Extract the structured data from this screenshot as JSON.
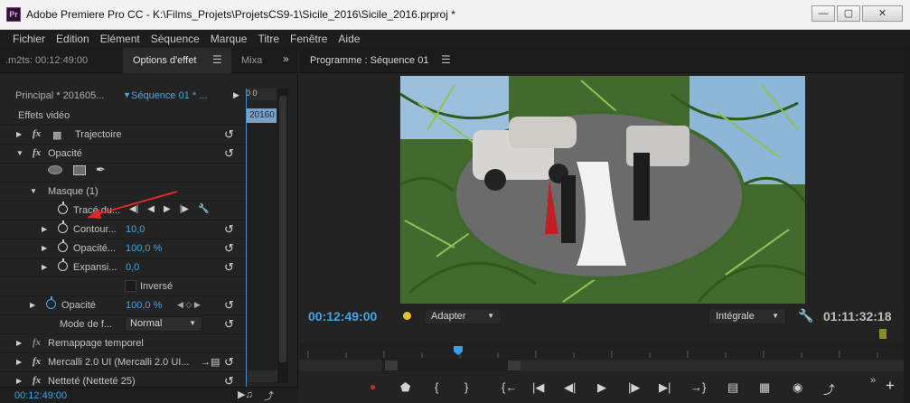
{
  "window": {
    "title": "Adobe Premiere Pro CC - K:\\Films_Projets\\ProjetsCS9-1\\Sicile_2016\\Sicile_2016.prproj *",
    "app_icon_text": "Pr"
  },
  "menu": [
    "Fichier",
    "Edition",
    "Elément",
    "Séquence",
    "Marque",
    "Titre",
    "Fenêtre",
    "Aide"
  ],
  "left_panel": {
    "tab_prev": ".m2ts: 00:12:49:00",
    "tab_active": "Options d'effet",
    "tab_next": "Mixa",
    "sequence_master": "Principal * 201605...",
    "sequence_clip": "Séquence 01 * ...",
    "timeline_ruler_label": "0 0",
    "timeline_clip_label": "20160",
    "section_label": "Effets vidéo",
    "rows": {
      "trajectoire": "Trajectoire",
      "opacite": "Opacité",
      "masque": "Masque (1)",
      "trace": "Tracé du...",
      "contour": "Contour...",
      "contour_val": "10,0",
      "opacite_masque": "Opacité...",
      "opacite_masque_val": "100,0 %",
      "expansion": "Expansi...",
      "expansion_val": "0,0",
      "inverse": "Inversé",
      "opacite2": "Opacité",
      "opacite2_val": "100,0 %",
      "mode": "Mode de f...",
      "mode_val": "Normal",
      "remappage": "Remappage temporel",
      "mercalli": "Mercalli 2.0 UI (Mercalli 2.0 UI...",
      "nettete": "Netteté (Netteté 25)"
    },
    "footer_timecode": "00:12:49:00"
  },
  "program_monitor": {
    "tab_label": "Programme : Séquence 01",
    "timecode_current": "00:12:49:00",
    "fit_label": "Adapter",
    "resolution_label": "Intégrale",
    "timecode_duration": "01:11:32:18"
  },
  "colors": {
    "accent_blue": "#3fa5ea",
    "mask_arrow": "#e0282a",
    "marker_yellow": "#e8c22a",
    "record_red": "#b72d2d"
  }
}
